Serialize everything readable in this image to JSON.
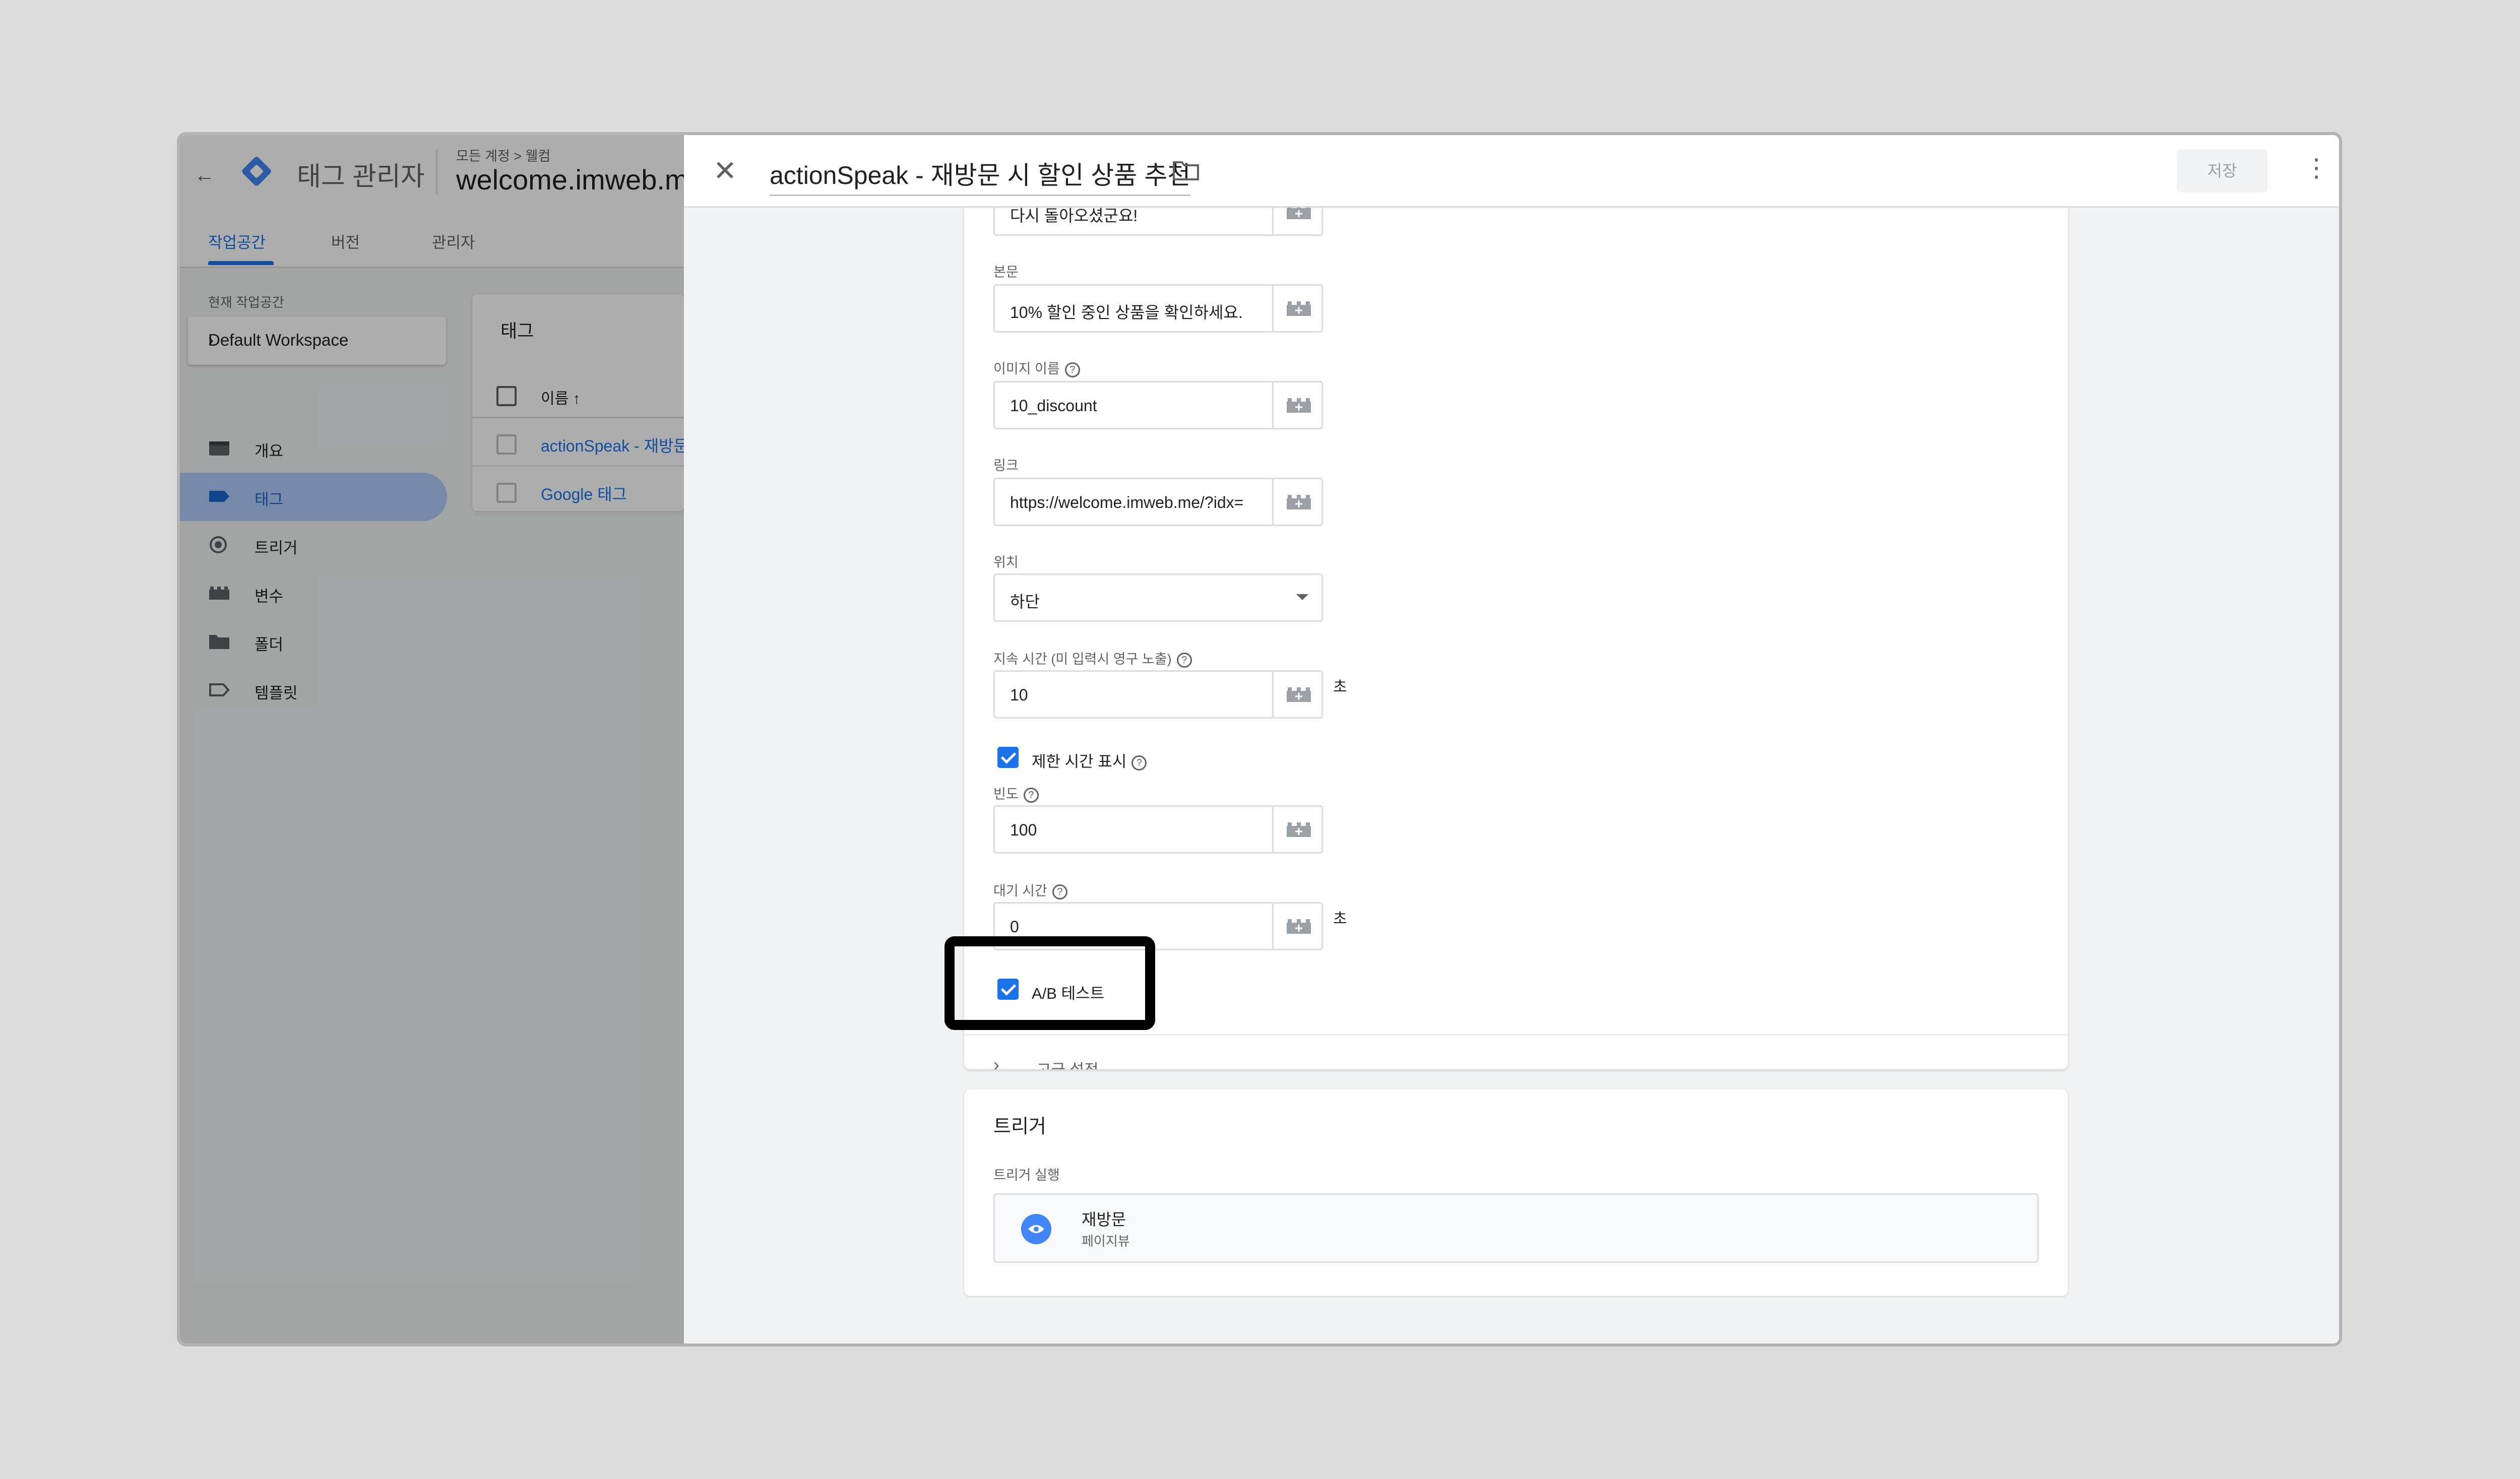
{
  "app": {
    "title": "태그 관리자",
    "breadcrumb": "모든 계정 > 웰컴",
    "container": "welcome.imweb.me"
  },
  "tabs": [
    "작업공간",
    "버전",
    "관리자"
  ],
  "workspace": {
    "label": "현재 작업공간",
    "name": "Default Workspace"
  },
  "sidebar": {
    "items": [
      {
        "label": "개요",
        "icon": "overview-icon"
      },
      {
        "label": "태그",
        "icon": "tag-icon"
      },
      {
        "label": "트리거",
        "icon": "trigger-icon"
      },
      {
        "label": "변수",
        "icon": "variable-icon"
      },
      {
        "label": "폴더",
        "icon": "folder-icon"
      },
      {
        "label": "템플릿",
        "icon": "template-icon"
      }
    ],
    "active": "태그"
  },
  "tags_list": {
    "title": "태그",
    "column": "이름 ↑",
    "rows": [
      "actionSpeak - 재방문 시 할인 상품 추천",
      "Google 태그"
    ]
  },
  "editor": {
    "tag_name": "actionSpeak - 재방문 시 할인 상품 추천",
    "save_label": "저장",
    "fields": {
      "title_value": "다시 돌아오셨군요!",
      "body_label": "본문",
      "body_value": "10% 할인 중인 상품을 확인하세요.",
      "image_label": "이미지 이름",
      "image_value": "10_discount",
      "link_label": "링크",
      "link_value": "https://welcome.imweb.me/?idx=",
      "position_label": "위치",
      "position_value": "하단",
      "duration_label": "지속 시간 (미 입력시 영구 노출)",
      "duration_value": "10",
      "duration_unit": "초",
      "show_timer_label": "제한 시간 표시",
      "frequency_label": "빈도",
      "frequency_value": "100",
      "wait_label": "대기 시간",
      "wait_value": "0",
      "wait_unit": "초",
      "ab_test_label": "A/B 테스트"
    },
    "advanced_label": "고급 설정"
  },
  "trigger": {
    "title": "트리거",
    "subtitle": "트리거 실행",
    "name": "재방문",
    "type": "페이지뷰"
  },
  "colors": {
    "accent": "#1a73e8",
    "active_nav_bg": "#aecbfa",
    "highlight_border": "#000000"
  }
}
